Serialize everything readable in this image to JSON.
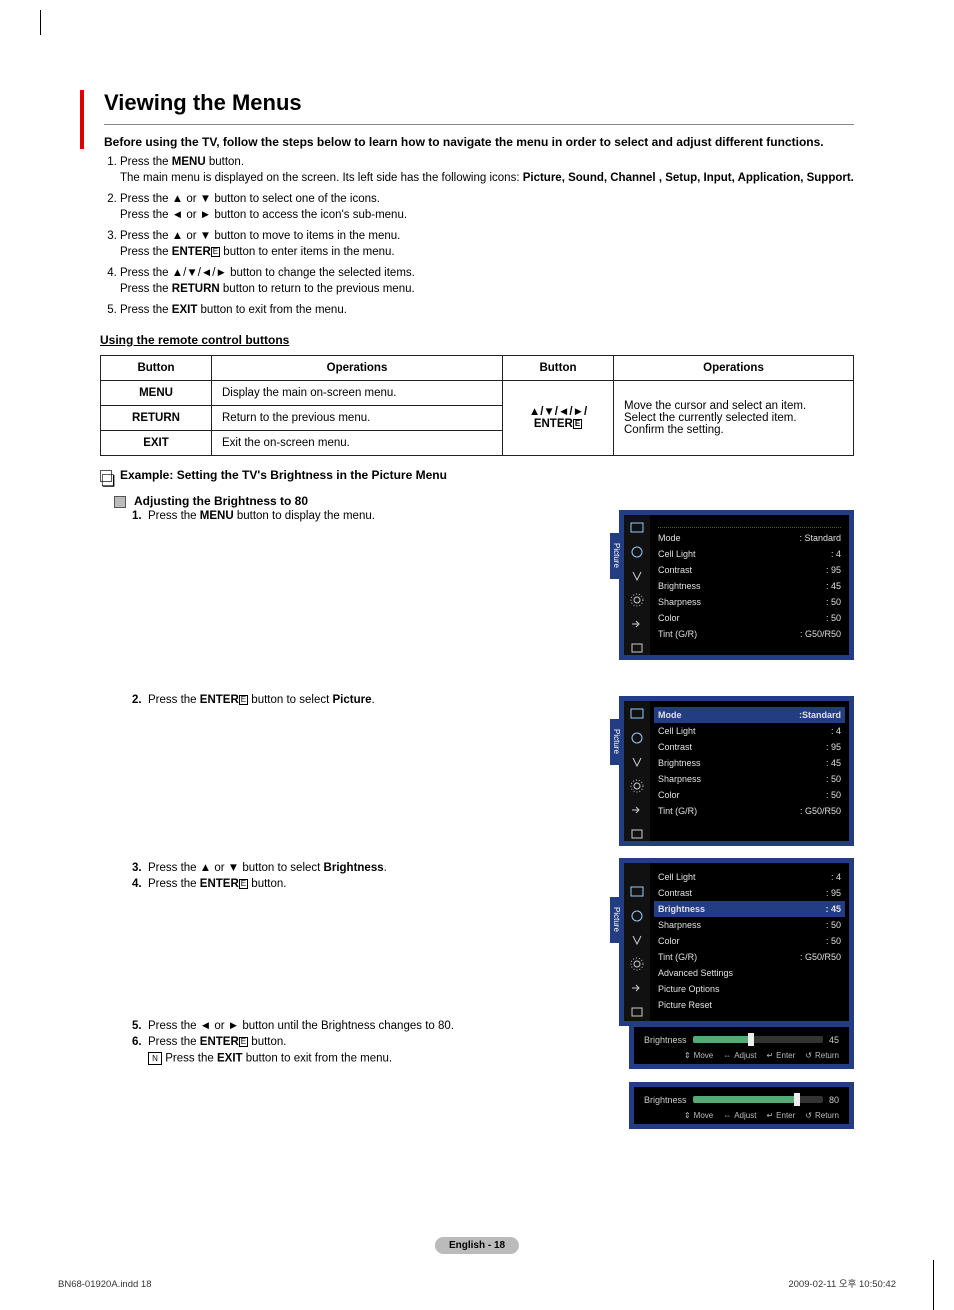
{
  "heading": "Viewing the Menus",
  "intro": "Before using the TV, follow the steps below to learn how to navigate the menu in order to select and adjust different functions.",
  "steps": {
    "s1a": "Press the ",
    "s1b": "MENU",
    "s1c": " button.",
    "s1d": "The main menu is displayed on the screen. Its left side has the following icons: ",
    "s1e": "Picture, Sound, Channel , Setup, Input, Application, Support.",
    "s2a": "Press the ▲ or ▼ button to select one of the icons.",
    "s2b": "Press the ◄ or ► button to access the icon's sub-menu.",
    "s3a": "Press the ▲ or ▼ button to move to items in the menu.",
    "s3b": "Press the ",
    "s3c": "ENTER",
    "s3d": " button to enter items in the menu.",
    "s4a": "Press the ▲/▼/◄/► button to change the selected items.",
    "s4b": "Press the ",
    "s4c": "RETURN",
    "s4d": " button to return to the previous menu.",
    "s5a": "Press the ",
    "s5b": "EXIT",
    "s5c": " button to exit from the menu."
  },
  "remoteHeading": "Using the remote control buttons",
  "table": {
    "h_button": "Button",
    "h_ops": "Operations",
    "r1_b": "MENU",
    "r1_o": "Display the main on-screen menu.",
    "r2_b": "RETURN",
    "r2_o": "Return to the previous menu.",
    "r3_b": "EXIT",
    "r3_o": "Exit the on-screen menu.",
    "r4_b1": "▲/▼/◄/►/",
    "r4_b2": "ENTER",
    "r4_o1": "Move the cursor and select an item.",
    "r4_o2": "Select the currently selected item.",
    "r4_o3": "Confirm the setting."
  },
  "example": {
    "title": "Example: Setting the TV's Brightness in the Picture Menu",
    "sub": "Adjusting the Brightness to 80",
    "e1a": "Press the ",
    "e1b": "MENU",
    "e1c": " button to display the menu.",
    "e2a": "Press the ",
    "e2b": "ENTER",
    "e2c": " button to select ",
    "e2d": "Picture",
    "e2e": ".",
    "e3a": "Press the ▲ or ▼ button to select ",
    "e3b": "Brightness",
    "e3c": ".",
    "e4a": "Press the ",
    "e4b": "ENTER",
    "e4c": " button.",
    "e5a": "Press the ◄ or ► button until the Brightness changes to 80.",
    "e6a": "Press the ",
    "e6b": "ENTER",
    "e6c": " button.",
    "e6n": "Press the ",
    "e6n2": "EXIT",
    "e6n3": " button to exit from the menu."
  },
  "osd": {
    "tab": "Picture",
    "items": {
      "mode": "Mode",
      "mode_v": ": Standard",
      "cell": "Cell Light",
      "cell_v": ": 4",
      "cont": "Contrast",
      "cont_v": ": 95",
      "bri": "Brightness",
      "bri_v": ": 45",
      "sharp": "Sharpness",
      "sharp_v": ": 50",
      "color": "Color",
      "color_v": ": 50",
      "tint": "Tint (G/R)",
      "tint_v": ": G50/R50",
      "adv": "Advanced Settings",
      "popt": "Picture Options",
      "prst": "Picture Reset",
      "mode_sel_v": ":Standard"
    }
  },
  "slider": {
    "label": "Brightness",
    "v45": "45",
    "v80": "80",
    "help_move": "Move",
    "help_adjust": "Adjust",
    "help_enter": "Enter",
    "help_return": "Return"
  },
  "footer": {
    "page": "English - 18",
    "left": "BN68-01920A.indd   18",
    "right": "2009-02-11   오후 10:50:42"
  }
}
